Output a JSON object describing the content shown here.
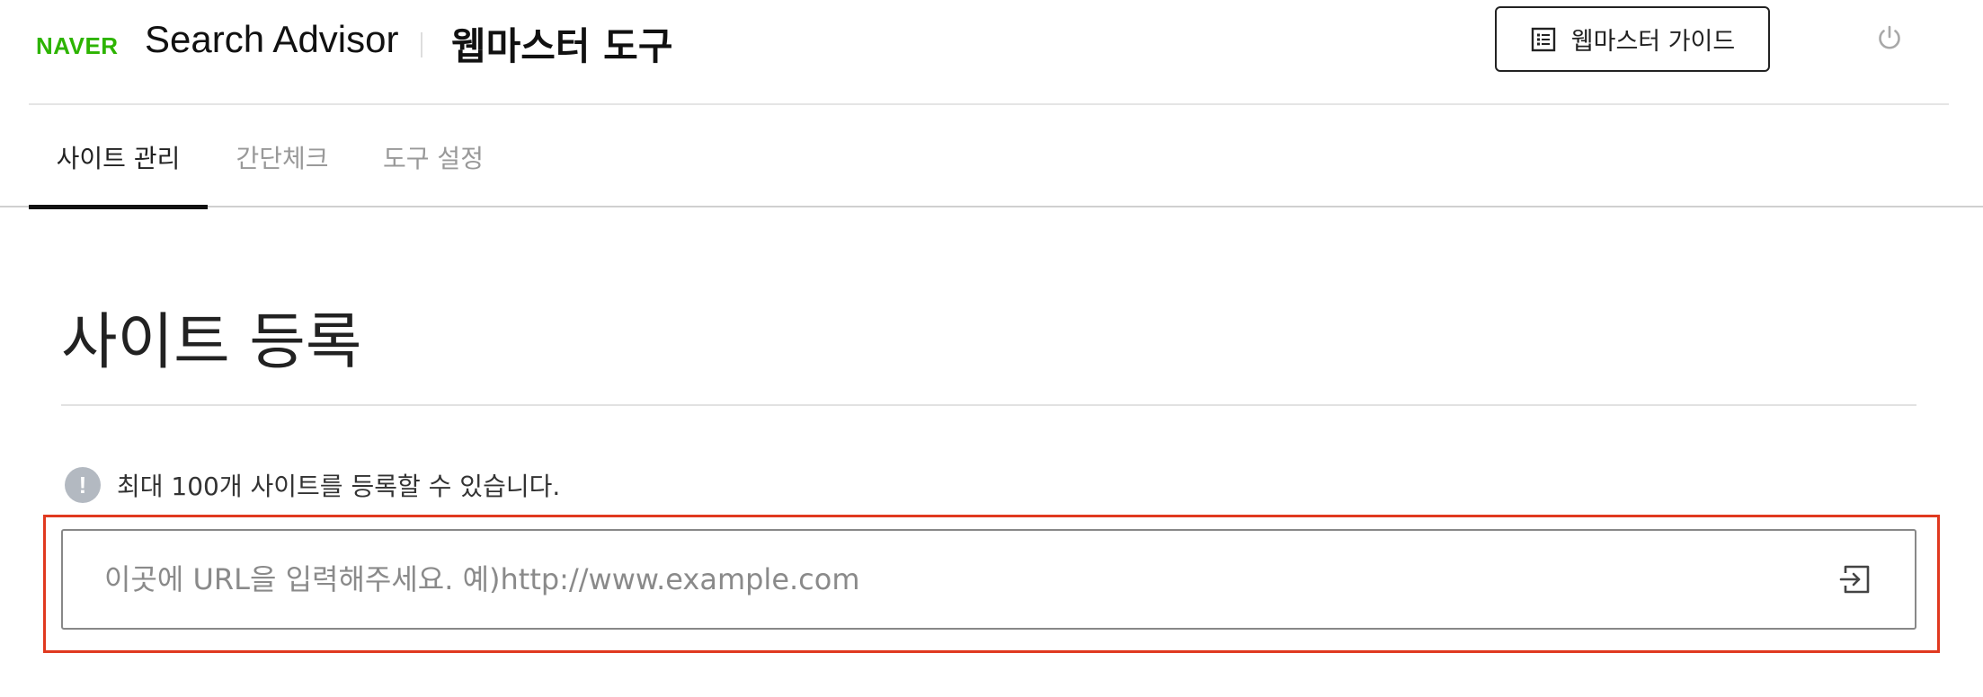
{
  "header": {
    "logo": "NAVER",
    "app_title": "Search Advisor",
    "tool_title": "웹마스터 도구",
    "guide_button_label": "웹마스터 가이드"
  },
  "tabs": [
    {
      "label": "사이트 관리",
      "active": true
    },
    {
      "label": "간단체크",
      "active": false
    },
    {
      "label": "도구 설정",
      "active": false
    }
  ],
  "main": {
    "heading": "사이트 등록",
    "notice_icon": "!",
    "notice": "최대 100개 사이트를 등록할 수 있습니다.",
    "url_input": {
      "value": "",
      "placeholder": "이곳에 URL을 입력해주세요. 예)http://www.example.com"
    }
  },
  "colors": {
    "brand": "#2db400",
    "highlight": "#e0391f",
    "notice_icon": "#b3b9c1"
  },
  "icons": {
    "guide": "list-icon",
    "power": "power-icon",
    "submit": "enter-arrow-icon",
    "notice": "exclamation-circle-icon"
  }
}
